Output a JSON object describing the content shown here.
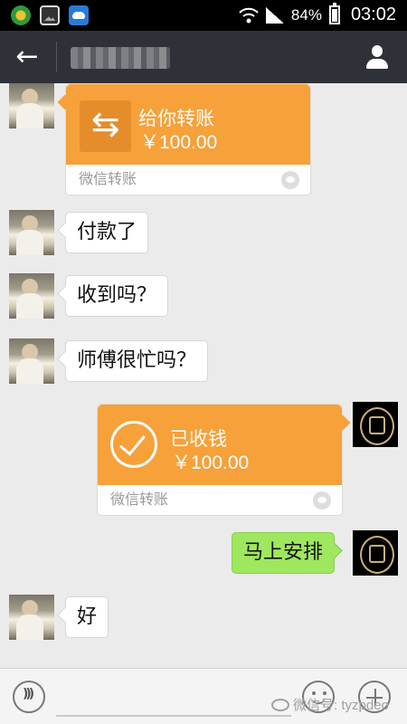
{
  "status_bar": {
    "battery": "84%",
    "time": "03:02",
    "icons": [
      "app-icon",
      "gallery-icon",
      "cloud-app-icon",
      "wifi-icon",
      "signal-icon",
      "battery-icon"
    ]
  },
  "header": {
    "contact_name_redacted": true,
    "icons": [
      "back-arrow-icon",
      "contact-info-icon"
    ]
  },
  "messages": [
    {
      "side": "left",
      "type": "transfer",
      "title": "给你转账",
      "amount": "￥100.00",
      "footer": "微信转账"
    },
    {
      "side": "left",
      "type": "text",
      "text": "付款了"
    },
    {
      "side": "left",
      "type": "text",
      "text": "收到吗？"
    },
    {
      "side": "left",
      "type": "text",
      "text": "师傅很忙吗？"
    },
    {
      "side": "right",
      "type": "transfer",
      "title": "已收钱",
      "amount": "￥100.00",
      "footer": "微信转账"
    },
    {
      "side": "right",
      "type": "text",
      "text": "马上安排"
    },
    {
      "side": "left",
      "type": "text",
      "text": "好"
    }
  ],
  "bottom_bar": {
    "watermark": "微信号: tyzpdeo",
    "icons": [
      "voice-icon",
      "emoji-icon",
      "plus-icon"
    ]
  },
  "colors": {
    "transfer_orange": "#f6a13a",
    "sent_green": "#9fe75e",
    "header_dark": "#2e3238",
    "chat_bg": "#ebebeb"
  }
}
